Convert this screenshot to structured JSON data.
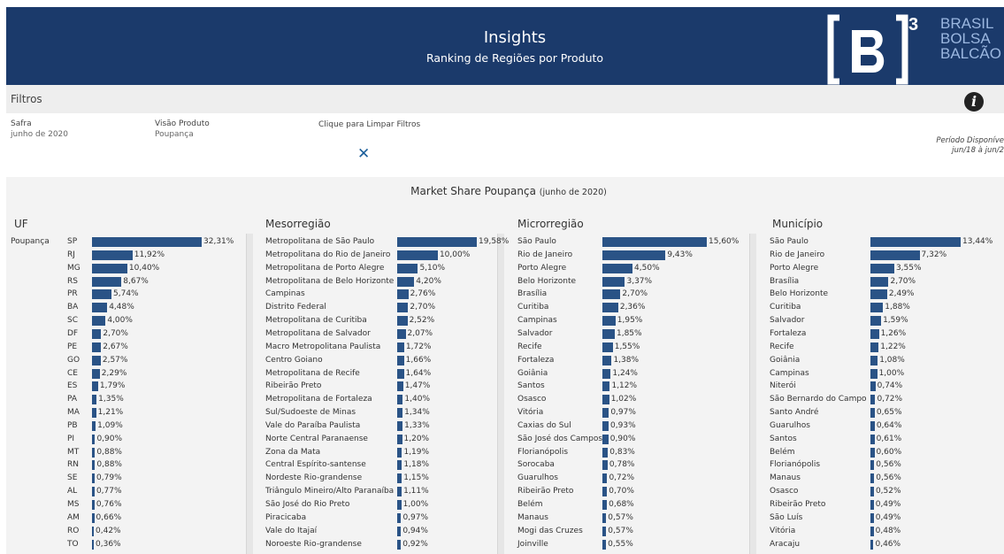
{
  "header": {
    "title": "Insights",
    "subtitle": "Ranking de Regiões por Produto",
    "logo_lines": [
      "BRASIL",
      "BOLSA",
      "BALCÃO"
    ],
    "brand_color": "#1b3a6b"
  },
  "filters": {
    "heading": "Filtros",
    "safra_label": "Safra",
    "safra_value": "junho de 2020",
    "visao_label": "Visão Produto",
    "visao_value": "Poupança",
    "clear_label": "Clique para Limpar Filtros",
    "periodo_line1": "Período Disponíve",
    "periodo_line2": "jun/18 à jun/2"
  },
  "market_share": {
    "title": "Market Share Poupança",
    "date": "(junho de 2020)"
  },
  "sections": {
    "uf": "UF",
    "meso": "Mesorregião",
    "micro": "Microrregião",
    "mun": "Município"
  },
  "chart_data": [
    {
      "type": "bar",
      "title": "UF",
      "group_label": "Poupança",
      "categories": [
        "SP",
        "RJ",
        "MG",
        "RS",
        "PR",
        "BA",
        "SC",
        "DF",
        "PE",
        "GO",
        "CE",
        "ES",
        "PA",
        "MA",
        "PB",
        "PI",
        "MT",
        "RN",
        "SE",
        "AL",
        "MS",
        "AM",
        "RO",
        "TO"
      ],
      "values": [
        32.31,
        11.92,
        10.4,
        8.67,
        5.74,
        4.48,
        4.0,
        2.7,
        2.67,
        2.57,
        2.29,
        1.79,
        1.35,
        1.21,
        1.09,
        0.9,
        0.88,
        0.88,
        0.79,
        0.77,
        0.76,
        0.66,
        0.42,
        0.36
      ],
      "labels": [
        "32,31%",
        "11,92%",
        "10,40%",
        "8,67%",
        "5,74%",
        "4,48%",
        "4,00%",
        "2,70%",
        "2,67%",
        "2,57%",
        "2,29%",
        "1,79%",
        "1,35%",
        "1,21%",
        "1,09%",
        "0,90%",
        "0,88%",
        "0,88%",
        "0,79%",
        "0,77%",
        "0,76%",
        "0,66%",
        "0,42%",
        "0,36%"
      ]
    },
    {
      "type": "bar",
      "title": "Mesorregião",
      "categories": [
        "Metropolitana de São Paulo",
        "Metropolitana do Rio de Janeiro",
        "Metropolitana de Porto Alegre",
        "Metropolitana de Belo Horizonte",
        "Campinas",
        "Distrito Federal",
        "Metropolitana de Curitiba",
        "Metropolitana de Salvador",
        "Macro Metropolitana Paulista",
        "Centro Goiano",
        "Metropolitana de Recife",
        "Ribeirão Preto",
        "Metropolitana de Fortaleza",
        "Sul/Sudoeste de Minas",
        "Vale do Paraíba Paulista",
        "Norte Central Paranaense",
        "Zona da Mata",
        "Central Espírito-santense",
        "Nordeste Rio-grandense",
        "Triângulo Mineiro/Alto Paranaíba",
        "São José do Rio Preto",
        "Piracicaba",
        "Vale do Itajaí",
        "Noroeste Rio-grandense"
      ],
      "values": [
        19.58,
        10.0,
        5.1,
        4.2,
        2.76,
        2.7,
        2.52,
        2.07,
        1.72,
        1.66,
        1.64,
        1.47,
        1.4,
        1.34,
        1.33,
        1.2,
        1.19,
        1.18,
        1.15,
        1.11,
        1.0,
        0.97,
        0.94,
        0.92
      ],
      "labels": [
        "19,58%",
        "10,00%",
        "5,10%",
        "4,20%",
        "2,76%",
        "2,70%",
        "2,52%",
        "2,07%",
        "1,72%",
        "1,66%",
        "1,64%",
        "1,47%",
        "1,40%",
        "1,34%",
        "1,33%",
        "1,20%",
        "1,19%",
        "1,18%",
        "1,15%",
        "1,11%",
        "1,00%",
        "0,97%",
        "0,94%",
        "0,92%"
      ]
    },
    {
      "type": "bar",
      "title": "Microrregião",
      "categories": [
        "São Paulo",
        "Rio de Janeiro",
        "Porto Alegre",
        "Belo Horizonte",
        "Brasília",
        "Curitiba",
        "Campinas",
        "Salvador",
        "Recife",
        "Fortaleza",
        "Goiânia",
        "Santos",
        "Osasco",
        "Vitória",
        "Caxias do Sul",
        "São José dos Campos",
        "Florianópolis",
        "Sorocaba",
        "Guarulhos",
        "Ribeirão Preto",
        "Belém",
        "Manaus",
        "Mogi das Cruzes",
        "Joinville"
      ],
      "values": [
        15.6,
        9.43,
        4.5,
        3.37,
        2.7,
        2.36,
        1.95,
        1.85,
        1.55,
        1.38,
        1.24,
        1.12,
        1.02,
        0.97,
        0.93,
        0.9,
        0.83,
        0.78,
        0.72,
        0.7,
        0.68,
        0.57,
        0.57,
        0.55
      ],
      "labels": [
        "15,60%",
        "9,43%",
        "4,50%",
        "3,37%",
        "2,70%",
        "2,36%",
        "1,95%",
        "1,85%",
        "1,55%",
        "1,38%",
        "1,24%",
        "1,12%",
        "1,02%",
        "0,97%",
        "0,93%",
        "0,90%",
        "0,83%",
        "0,78%",
        "0,72%",
        "0,70%",
        "0,68%",
        "0,57%",
        "0,57%",
        "0,55%"
      ]
    },
    {
      "type": "bar",
      "title": "Município",
      "categories": [
        "São Paulo",
        "Rio de Janeiro",
        "Porto Alegre",
        "Brasília",
        "Belo Horizonte",
        "Curitiba",
        "Salvador",
        "Fortaleza",
        "Recife",
        "Goiânia",
        "Campinas",
        "Niterói",
        "São Bernardo do Campo",
        "Santo André",
        "Guarulhos",
        "Santos",
        "Belém",
        "Florianópolis",
        "Manaus",
        "Osasco",
        "Ribeirão Preto",
        "São Luís",
        "Vitória",
        "Aracaju"
      ],
      "values": [
        13.44,
        7.32,
        3.55,
        2.7,
        2.49,
        1.88,
        1.59,
        1.26,
        1.22,
        1.08,
        1.0,
        0.74,
        0.72,
        0.65,
        0.64,
        0.61,
        0.6,
        0.56,
        0.56,
        0.52,
        0.49,
        0.49,
        0.48,
        0.46
      ],
      "labels": [
        "13,44%",
        "7,32%",
        "3,55%",
        "2,70%",
        "2,49%",
        "1,88%",
        "1,59%",
        "1,26%",
        "1,22%",
        "1,08%",
        "1,00%",
        "0,74%",
        "0,72%",
        "0,65%",
        "0,64%",
        "0,61%",
        "0,60%",
        "0,56%",
        "0,56%",
        "0,52%",
        "0,49%",
        "0,49%",
        "0,48%",
        "0,46%"
      ]
    }
  ]
}
